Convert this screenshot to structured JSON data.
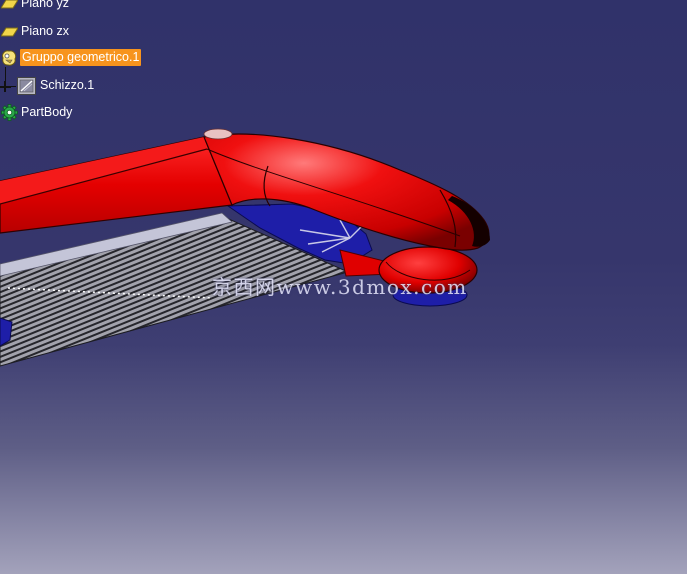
{
  "spec_tree": {
    "items": [
      {
        "label": "Piano yz",
        "icon": "plane-icon"
      },
      {
        "label": "Piano zx",
        "icon": "plane-icon"
      },
      {
        "label": "Gruppo geometrico.1",
        "icon": "geometrical-set-icon",
        "selected": true
      },
      {
        "label": "Schizzo.1",
        "icon": "sketch-icon",
        "expander_icon": "expand-plus-icon"
      },
      {
        "label": "PartBody",
        "icon": "part-body-gear-icon"
      }
    ]
  },
  "viewport": {
    "background_top": "#30326a",
    "background_bottom": "#a3a2bb",
    "part_color": "#e60000",
    "secondary_color": "#1e1ea8",
    "base_color": "#9a9aa4"
  },
  "selection_highlight_color": "#f7941d",
  "watermark": {
    "text": "京西网www.3dmox.com"
  }
}
